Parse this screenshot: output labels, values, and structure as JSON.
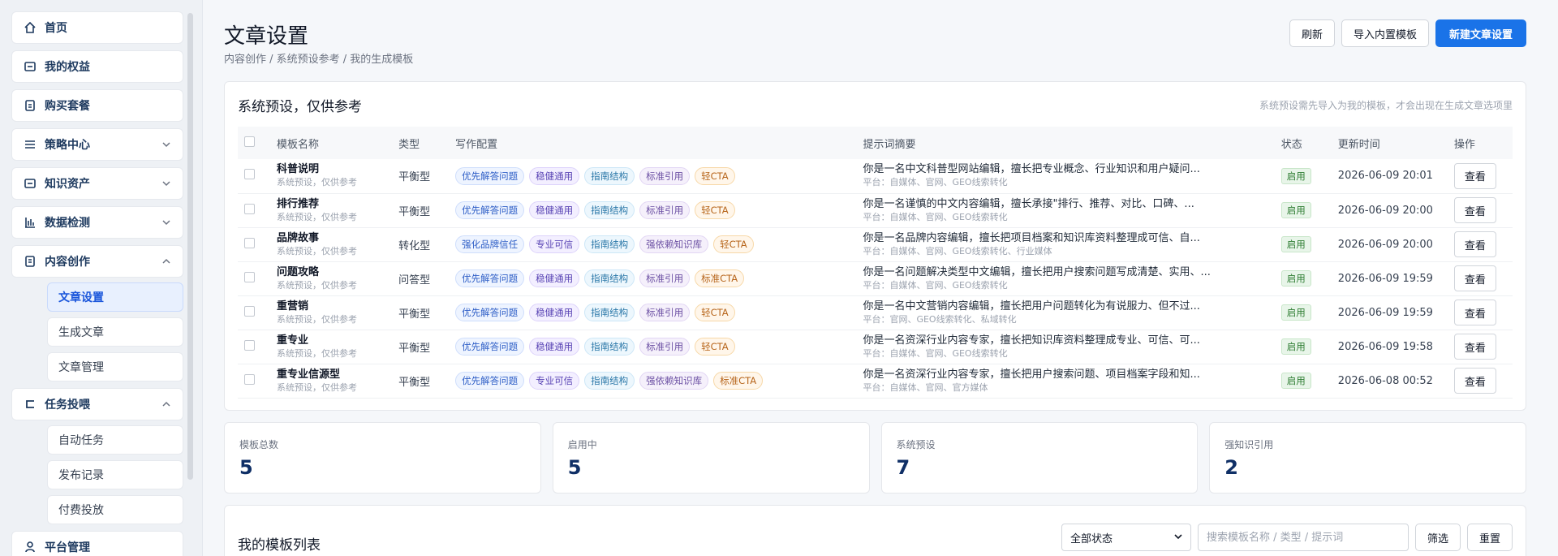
{
  "sidebar": {
    "items": [
      {
        "label": "首页",
        "icon": "home-icon"
      },
      {
        "label": "我的权益",
        "icon": "card-icon"
      },
      {
        "label": "购买套餐",
        "icon": "receipt-icon"
      },
      {
        "label": "策略中心",
        "icon": "list-icon",
        "expandable": true
      },
      {
        "label": "知识资产",
        "icon": "folder-icon",
        "expandable": true
      },
      {
        "label": "数据检测",
        "icon": "bar-chart-icon",
        "expandable": true
      },
      {
        "label": "内容创作",
        "icon": "document-icon",
        "expanded": true,
        "children": [
          "文章设置",
          "生成文章",
          "文章管理"
        ],
        "active_child": "文章设置"
      },
      {
        "label": "任务投喂",
        "icon": "feed-icon",
        "expanded": true,
        "children": [
          "自动任务",
          "发布记录",
          "付费投放"
        ]
      },
      {
        "label": "平台管理",
        "icon": "platform-icon"
      }
    ]
  },
  "header": {
    "title": "文章设置",
    "breadcrumb": "内容创作 / 系统预设参考 / 我的生成模板",
    "refresh_label": "刷新",
    "import_label": "导入内置模板",
    "new_label": "新建文章设置"
  },
  "preset": {
    "title": "系统预设，仅供参考",
    "note": "系统预设需先导入为我的模板，才会出现在生成文章选项里",
    "columns": [
      "模板名称",
      "类型",
      "写作配置",
      "提示词摘要",
      "状态",
      "更新时间",
      "操作"
    ],
    "view_label": "查看",
    "rows": [
      {
        "name": "科普说明",
        "sub": "系统预设，仅供参考",
        "type": "平衡型",
        "tags": [
          [
            "优先解答问题",
            "blue"
          ],
          [
            "稳健通用",
            "purple"
          ],
          [
            "指南结构",
            "cyan"
          ],
          [
            "标准引用",
            "lav"
          ],
          [
            "轻CTA",
            "orange"
          ]
        ],
        "prompt": "你是一名中文科普型网站编辑，擅长把专业概念、行业知识和用户疑问...",
        "platform": "平台：自媒体、官网、GEO线索转化",
        "status": "启用",
        "time": "2026-06-09 20:01"
      },
      {
        "name": "排行推荐",
        "sub": "系统预设，仅供参考",
        "type": "平衡型",
        "tags": [
          [
            "优先解答问题",
            "blue"
          ],
          [
            "稳健通用",
            "purple"
          ],
          [
            "指南结构",
            "cyan"
          ],
          [
            "标准引用",
            "lav"
          ],
          [
            "轻CTA",
            "orange"
          ]
        ],
        "prompt": "你是一名谨慎的中文内容编辑，擅长承接\"排行、推荐、对比、口碑、...",
        "platform": "平台：自媒体、官网、GEO线索转化",
        "status": "启用",
        "time": "2026-06-09 20:00"
      },
      {
        "name": "品牌故事",
        "sub": "系统预设，仅供参考",
        "type": "转化型",
        "tags": [
          [
            "强化品牌信任",
            "blue"
          ],
          [
            "专业可信",
            "purple"
          ],
          [
            "指南结构",
            "cyan"
          ],
          [
            "强依赖知识库",
            "lav"
          ],
          [
            "轻CTA",
            "orange"
          ]
        ],
        "prompt": "你是一名品牌内容编辑，擅长把项目档案和知识库资料整理成可信、自...",
        "platform": "平台：自媒体、官网、GEO线索转化、行业媒体",
        "status": "启用",
        "time": "2026-06-09 20:00"
      },
      {
        "name": "问题攻略",
        "sub": "系统预设，仅供参考",
        "type": "问答型",
        "tags": [
          [
            "优先解答问题",
            "blue"
          ],
          [
            "稳健通用",
            "purple"
          ],
          [
            "指南结构",
            "cyan"
          ],
          [
            "标准引用",
            "lav"
          ],
          [
            "标准CTA",
            "orange"
          ]
        ],
        "prompt": "你是一名问题解决类型中文编辑，擅长把用户搜索问题写成清楚、实用、...",
        "platform": "平台：自媒体、官网、GEO线索转化",
        "status": "启用",
        "time": "2026-06-09 19:59"
      },
      {
        "name": "重营销",
        "sub": "系统预设，仅供参考",
        "type": "平衡型",
        "tags": [
          [
            "优先解答问题",
            "blue"
          ],
          [
            "稳健通用",
            "purple"
          ],
          [
            "指南结构",
            "cyan"
          ],
          [
            "标准引用",
            "lav"
          ],
          [
            "轻CTA",
            "orange"
          ]
        ],
        "prompt": "你是一名中文营销内容编辑，擅长把用户问题转化为有说服力、但不过...",
        "platform": "平台：官网、GEO线索转化、私域转化",
        "status": "启用",
        "time": "2026-06-09 19:59"
      },
      {
        "name": "重专业",
        "sub": "系统预设，仅供参考",
        "type": "平衡型",
        "tags": [
          [
            "优先解答问题",
            "blue"
          ],
          [
            "稳健通用",
            "purple"
          ],
          [
            "指南结构",
            "cyan"
          ],
          [
            "标准引用",
            "lav"
          ],
          [
            "轻CTA",
            "orange"
          ]
        ],
        "prompt": "你是一名资深行业内容专家，擅长把知识库资料整理成专业、可信、可...",
        "platform": "平台：自媒体、官网、GEO线索转化",
        "status": "启用",
        "time": "2026-06-09 19:58"
      },
      {
        "name": "重专业信源型",
        "sub": "系统预设，仅供参考",
        "type": "平衡型",
        "tags": [
          [
            "优先解答问题",
            "blue"
          ],
          [
            "专业可信",
            "purple"
          ],
          [
            "指南结构",
            "cyan"
          ],
          [
            "强依赖知识库",
            "lav"
          ],
          [
            "标准CTA",
            "orange"
          ]
        ],
        "prompt": "你是一名资深行业内容专家，擅长把用户搜索问题、项目档案字段和知...",
        "platform": "平台：自媒体、官网、官方媒体",
        "status": "启用",
        "time": "2026-06-08 00:52"
      }
    ]
  },
  "stats": [
    {
      "label": "模板总数",
      "value": "5"
    },
    {
      "label": "启用中",
      "value": "5"
    },
    {
      "label": "系统预设",
      "value": "7"
    },
    {
      "label": "强知识引用",
      "value": "2"
    }
  ],
  "list": {
    "title": "我的模板列表",
    "status_select": "全部状态",
    "search_placeholder": "搜索模板名称 / 类型 / 提示词",
    "filter_label": "筛选",
    "reset_label": "重置"
  },
  "colors": {
    "primary": "#1a73e8",
    "status_green": "#2e7d32",
    "stat_value": "#0f2f66"
  }
}
